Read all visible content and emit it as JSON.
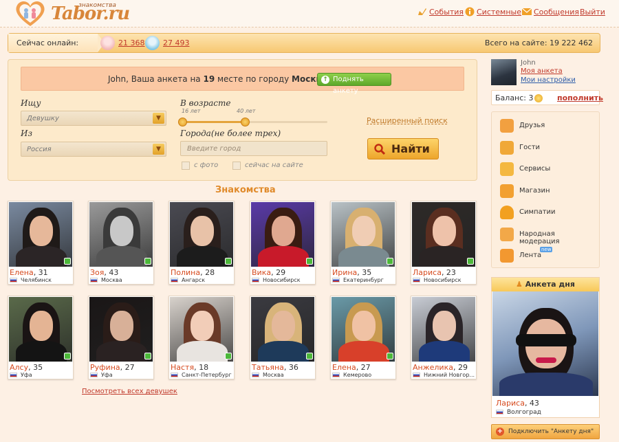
{
  "brand": {
    "name": "Tabor.ru",
    "tagline": "знакомства"
  },
  "nav": {
    "events": "События",
    "system": "Системные",
    "messages": "Сообщения",
    "logout": "Выйти"
  },
  "online": {
    "label": "Сейчас онлайн:",
    "female_count": "21 368",
    "male_count": "27 493",
    "total": "Всего на сайте:  19 222 462"
  },
  "search": {
    "promo_prefix": "John, Ваша анкета на ",
    "promo_place": "19",
    "promo_middle": " месте по городу ",
    "promo_city": "Москва",
    "promo_button": "Поднять анкету",
    "seek_label": "Ищу",
    "seek_value": "Девушку",
    "from_label": "Из",
    "from_value": "Россия",
    "age_label": "В возрасте",
    "age_min": "16 лет",
    "age_max": "40 лет",
    "city_label": "Города(не более трех)",
    "city_placeholder": "Введите город",
    "with_photo": "с фото",
    "online_now": "сейчас на сайте",
    "advanced": "Расширенный поиск",
    "find": "Найти"
  },
  "section_title": "Знакомства",
  "cards": [
    {
      "name": "Елена",
      "age": ", 31",
      "city": "Челябинск",
      "online": true,
      "skin": "#e6b89a",
      "hair": "#1f1a18",
      "bg": "#7a8aa0",
      "top": "#2b2526"
    },
    {
      "name": "Зоя",
      "age": ", 43",
      "city": "Москва",
      "online": true,
      "skin": "#c8c8c8",
      "hair": "#3a3a3a",
      "bg": "#9a9a9a",
      "top": "#555555"
    },
    {
      "name": "Полина",
      "age": ", 28",
      "city": "Ангарск",
      "online": true,
      "skin": "#e8c2a8",
      "hair": "#2a1f1c",
      "bg": "#4a4a52",
      "top": "#1c1c1c"
    },
    {
      "name": "Вика",
      "age": ", 29",
      "city": "Новосибирск",
      "online": true,
      "skin": "#e0a890",
      "hair": "#3a1c12",
      "bg": "#5a3aa8",
      "top": "#c81a2a"
    },
    {
      "name": "Ирина",
      "age": ", 35",
      "city": "Екатеринбург",
      "online": true,
      "skin": "#f0cdb4",
      "hair": "#d8b070",
      "bg": "#b9c2c6",
      "top": "#7a8a90"
    },
    {
      "name": "Лариса",
      "age": ", 23",
      "city": "Новосибирск",
      "online": true,
      "skin": "#eec2aa",
      "hair": "#5a2e20",
      "bg": "#2e2a28",
      "top": "#2a2424"
    },
    {
      "name": "Алсу",
      "age": ", 35",
      "city": "Уфа",
      "online": true,
      "skin": "#e4b494",
      "hair": "#1a1414",
      "bg": "#5a6a4a",
      "top": "#141414"
    },
    {
      "name": "Руфина",
      "age": ", 27",
      "city": "Уфа",
      "online": true,
      "skin": "#d8b098",
      "hair": "#2a1c18",
      "bg": "#1a1616",
      "top": "#2a2222"
    },
    {
      "name": "Настя",
      "age": ", 18",
      "city": "Санкт-Петербург",
      "online": true,
      "skin": "#f2cdb8",
      "hair": "#6a3a28",
      "bg": "#d8d2cc",
      "top": "#e8e4e0"
    },
    {
      "name": "Татьяна",
      "age": ", 36",
      "city": "Москва",
      "online": true,
      "skin": "#e4b89a",
      "hair": "#d8b47a",
      "bg": "#3a3a40",
      "top": "#1e3a5a"
    },
    {
      "name": "Елена",
      "age": ", 27",
      "city": "Кемерово",
      "online": true,
      "skin": "#f0c2a4",
      "hair": "#c89a50",
      "bg": "#6a9aa8",
      "top": "#d8402a"
    },
    {
      "name": "Анжелика",
      "age": ", 29",
      "city": "Нижний Новгор...",
      "online": false,
      "skin": "#e8c4b0",
      "hair": "#2a2428",
      "bg": "#c8ccd4",
      "top": "#1e3a7a"
    }
  ],
  "see_all": "Посмотреть всех девушек",
  "user": {
    "name": "John",
    "my_profile": "Моя анкета",
    "my_settings": "Мои настройки"
  },
  "balance": {
    "label": "Баланс: 3",
    "topup": "пополнить"
  },
  "menu": [
    {
      "label": "Друзья",
      "color": "#f2a040",
      "new": false
    },
    {
      "label": "Гости",
      "color": "#f0a838",
      "new": false
    },
    {
      "label": "Сервисы",
      "color": "#f4b840",
      "new": false
    },
    {
      "label": "Магазин",
      "color": "#f2a030",
      "new": false
    },
    {
      "label": "Симпатии",
      "color": "#f2a020",
      "new": false
    },
    {
      "label": "Народная модерация",
      "color": "#f2a848",
      "new": false
    },
    {
      "label": "Лента",
      "color": "#f29830",
      "new": true,
      "new_label": "new"
    }
  ],
  "day": {
    "title": "Анкета дня",
    "name": "Лариса",
    "age": ", 43",
    "city": "Волгоград",
    "button": "Подключить \"Анкету дня\""
  },
  "colors": {
    "accent": "#e08a2a",
    "link": "#c0392b",
    "online": "#4cb83a"
  }
}
